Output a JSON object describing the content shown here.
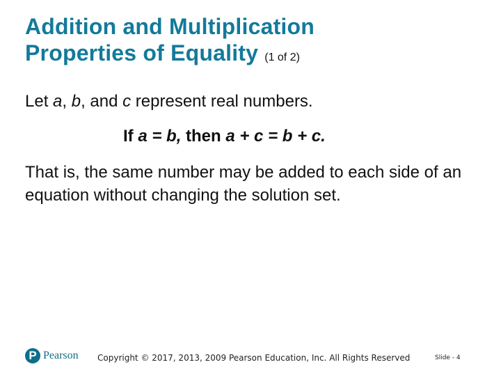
{
  "title": {
    "line1": "Addition and Multiplication",
    "line2": "Properties of Equality",
    "part": "(1 of 2)"
  },
  "intro": {
    "t1": "Let ",
    "a": "a",
    "t2": ", ",
    "b": "b",
    "t3": ", and ",
    "c": "c",
    "t4": " represent real numbers."
  },
  "rule": {
    "if": "If ",
    "cond": "a = b,",
    "then": " then ",
    "conclusion": "a + c = b + c."
  },
  "explanation": "That is, the same number may be added to each side of an equation without changing the solution set.",
  "footer": {
    "logo_letter": "P",
    "logo_text": "Pearson",
    "copyright": "Copyright © 2017, 2013, 2009 Pearson Education, Inc. All Rights Reserved",
    "slide_number": "Slide - 4"
  },
  "colors": {
    "title": "#137a9a",
    "brand": "#0f6e8a"
  }
}
